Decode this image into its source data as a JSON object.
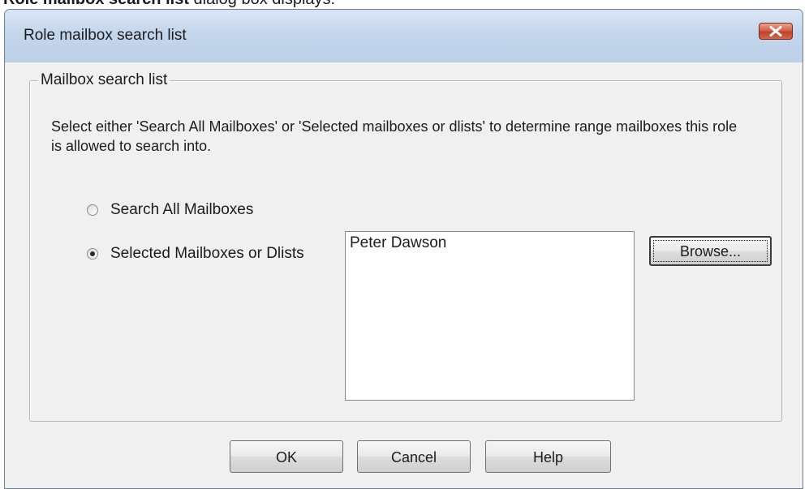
{
  "caption": {
    "bold": "Role mailbox search list",
    "rest": " dialog box displays."
  },
  "dialog": {
    "title": "Role mailbox search list",
    "close_icon": "close-icon"
  },
  "group": {
    "legend": "Mailbox search list",
    "description": "Select either 'Search All Mailboxes' or 'Selected mailboxes or dlists' to determine range mailboxes this role is allowed to search into."
  },
  "radios": {
    "all": {
      "label": "Search All Mailboxes",
      "selected": false
    },
    "selected": {
      "label": "Selected Mailboxes or Dlists",
      "selected": true
    }
  },
  "list": {
    "items": [
      "Peter Dawson"
    ]
  },
  "buttons": {
    "browse": "Browse...",
    "ok": "OK",
    "cancel": "Cancel",
    "help": "Help"
  },
  "colors": {
    "titlebar": "#c4d6ec",
    "close": "#c0402a",
    "dialog_bg": "#f0f0f0"
  }
}
